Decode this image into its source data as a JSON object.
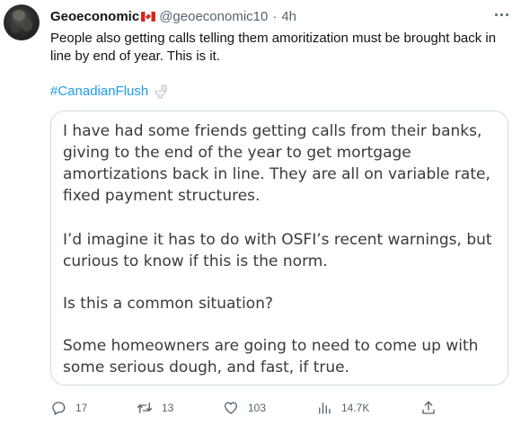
{
  "author": {
    "name": "Geoeconomic",
    "flag_icon": "canada-flag",
    "handle": "@geoeconomic10",
    "separator": "·",
    "time": "4h"
  },
  "tweet": {
    "text": "People also getting calls telling them amoritization must be brought back in line by end of year. This is it.",
    "hashtag": "#CanadianFlush",
    "emoji_icon": "toilet-icon"
  },
  "image": {
    "paragraphs": [
      "I have had some friends getting calls from their banks, giving to the end of the year to get mortgage amortizations back in line. They are all on variable rate, fixed payment structures.",
      "I’d imagine it has to do with OSFI’s recent warnings, but curious to know if this is the norm.",
      "Is this a common situation?",
      "Some homeowners are going to need to come up with some serious dough, and fast, if true."
    ]
  },
  "actions": {
    "replies": "17",
    "retweets": "13",
    "likes": "103",
    "views": "14.7K"
  },
  "colors": {
    "text": "#0f1419",
    "secondary": "#536471",
    "link": "#1d9bf0",
    "border": "#cfd9de"
  }
}
